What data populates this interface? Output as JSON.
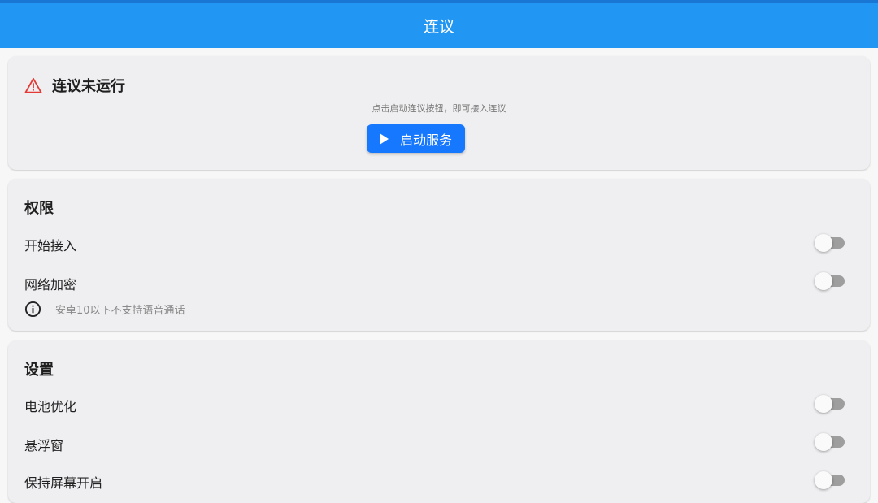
{
  "appbar": {
    "title": "连议"
  },
  "status_card": {
    "title": "连议未运行",
    "subtitle": "点击启动连议按钮，即可接入连议",
    "start_button_label": "启动服务",
    "warn_icon": "warning-triangle-icon",
    "accent_color": "#1677ff"
  },
  "permissions": {
    "title": "权限",
    "items": [
      {
        "label": "开始接入",
        "enabled": false
      },
      {
        "label": "网络加密",
        "enabled": false
      }
    ],
    "hint": "安卓10以下不支持语音通话",
    "hint_icon": "info-icon"
  },
  "settings": {
    "title": "设置",
    "items": [
      {
        "label": "电池优化",
        "enabled": false
      },
      {
        "label": "悬浮窗",
        "enabled": false
      },
      {
        "label": "保持屏幕开启",
        "enabled": false
      }
    ]
  },
  "colors": {
    "appbar": "#2196f3",
    "warning": "#e53935"
  }
}
